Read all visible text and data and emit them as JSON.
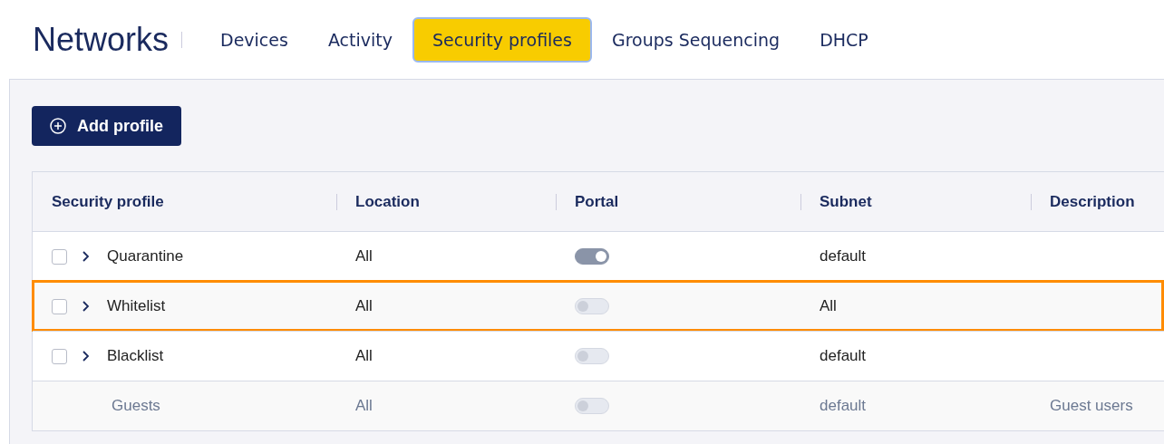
{
  "header": {
    "title": "Networks",
    "tabs": [
      {
        "label": "Devices",
        "selected": false
      },
      {
        "label": "Activity",
        "selected": false
      },
      {
        "label": "Security profiles",
        "selected": true
      },
      {
        "label": "Groups Sequencing",
        "selected": false
      },
      {
        "label": "DHCP",
        "selected": false
      }
    ]
  },
  "add_button": {
    "label": "Add profile"
  },
  "table": {
    "columns": [
      "Security profile",
      "Location",
      "Portal",
      "Subnet",
      "Description"
    ],
    "rows": [
      {
        "name": "Quarantine",
        "location": "All",
        "portal_on": true,
        "subnet": "default",
        "disabled": false,
        "highlighted": false
      },
      {
        "name": "Whitelist",
        "location": "All",
        "portal_on": false,
        "subnet": "All",
        "disabled": false,
        "highlighted": true
      },
      {
        "name": "Blacklist",
        "location": "All",
        "portal_on": false,
        "subnet": "default",
        "disabled": false,
        "highlighted": false
      },
      {
        "name": "Guests",
        "location": "All",
        "portal_on": false,
        "subnet": "default",
        "description": "Guest users",
        "disabled": true,
        "highlighted": false
      }
    ]
  }
}
